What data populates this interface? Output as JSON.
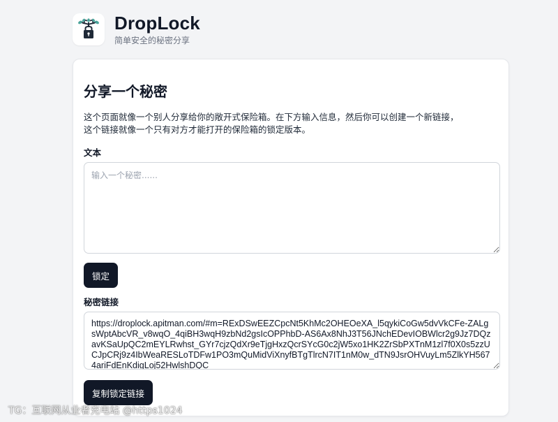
{
  "brand": {
    "title": "DropLock",
    "subtitle": "简单安全的秘密分享",
    "logo_icon": "tree-padlock-icon"
  },
  "card": {
    "title": "分享一个秘密",
    "description_line1": "这个页面就像一个别人分享给你的敞开式保险箱。在下方输入信息，然后你可以创建一个新链接，",
    "description_line2": "这个链接就像一个只有对方才能打开的保险箱的锁定版本。"
  },
  "secret_field": {
    "label": "文本",
    "placeholder": "输入一个秘密......",
    "value": ""
  },
  "lock_button": {
    "label": "锁定"
  },
  "link_field": {
    "label": "秘密链接",
    "value": "https://droplock.apitman.com/#m=RExDSwEEZCpcNt5KhMc2OHEOeXA_l5qykiCoGw5dvVkCFe-ZALgsWptAbcVR_v8wqO_4qiBH3wqH9zbNd2gsIcOPPhbD-AS6Ax8NhJ3T56JNchEDevIOBWlcr2g9Jz7DQzavKSaUpQC2mEYLRwhst_GYr7cjzQdXr9eTjgHxzQcrSYcG0c2jW5xo1HK2ZrSbPXTnM1zl7f0X0s5zzUCJpCRj9z4IbWeaRESLoTDFw1PO3mQuMidViXnyfBTgTlrcN7IT1nM0w_dTN9JsrOHVuyLm5ZlkYH5674ariFdEnKdigLoj52HwlshDQC"
  },
  "copy_button": {
    "label": "复制锁定链接"
  },
  "watermark": {
    "text": "TG：互联网从业者充电站 @https1024"
  },
  "colors": {
    "page_background": "#f3f4f6",
    "card_background": "#ffffff",
    "button_background": "#111827",
    "button_text": "#ffffff",
    "border": "#d1d5db"
  }
}
